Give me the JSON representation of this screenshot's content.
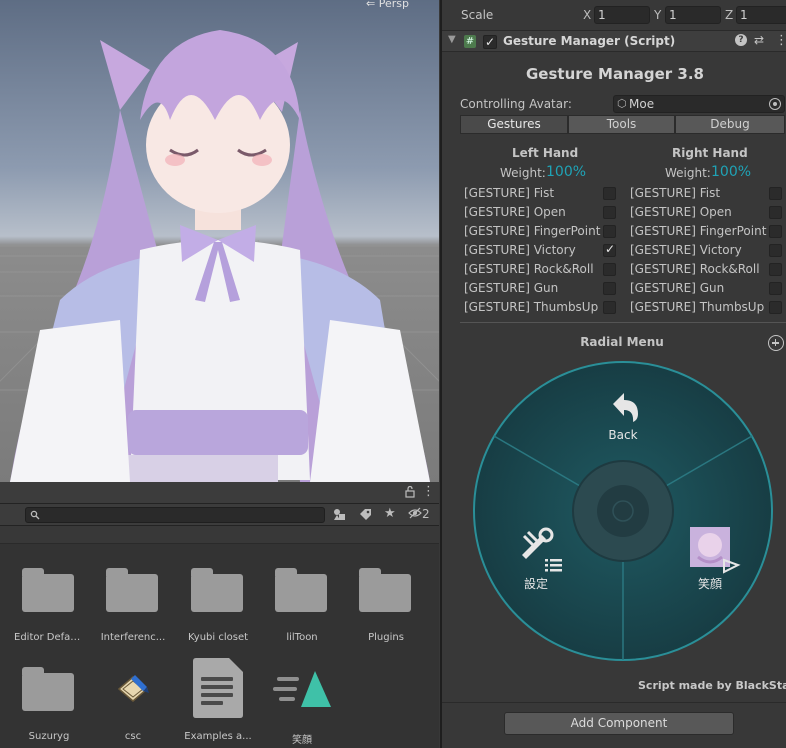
{
  "scene": {
    "view_label": "Persp"
  },
  "project": {
    "hidden_count": "2",
    "assets": [
      {
        "label": "Editor Defau...",
        "icon": "folder-icon"
      },
      {
        "label": "Interferenc...",
        "icon": "folder-icon"
      },
      {
        "label": "Kyubi closet",
        "icon": "folder-icon"
      },
      {
        "label": "lilToon",
        "icon": "folder-icon"
      },
      {
        "label": "Plugins",
        "icon": "folder-icon"
      },
      {
        "label": "Suzuryg",
        "icon": "folder-icon"
      },
      {
        "label": "csc",
        "icon": "script-asset-icon"
      },
      {
        "label": "Examples a...",
        "icon": "text-document-icon"
      },
      {
        "label": "笑顔",
        "icon": "animation-clip-icon"
      }
    ]
  },
  "inspector": {
    "scale": {
      "label": "Scale",
      "x_label": "X",
      "x": "1",
      "y_label": "Y",
      "y": "1",
      "z_label": "Z",
      "z": "1"
    },
    "component": {
      "title": "Gesture Manager (Script)",
      "heading": "Gesture Manager 3.8",
      "avatar_label": "Controlling Avatar:",
      "avatar_value": "Moe",
      "tabs": [
        "Gestures",
        "Tools",
        "Debug"
      ],
      "active_tab": "Gestures",
      "left_hand": {
        "title": "Left Hand",
        "weight_label": "Weight:",
        "weight_value": "100%",
        "gestures": [
          "[GESTURE] Fist",
          "[GESTURE] Open",
          "[GESTURE] FingerPoint",
          "[GESTURE] Victory",
          "[GESTURE] Rock&Roll",
          "[GESTURE] Gun",
          "[GESTURE] ThumbsUp"
        ],
        "checked": [
          false,
          false,
          false,
          true,
          false,
          false,
          false
        ]
      },
      "right_hand": {
        "title": "Right Hand",
        "weight_label": "Weight:",
        "weight_value": "100%",
        "gestures": [
          "[GESTURE] Fist",
          "[GESTURE] Open",
          "[GESTURE] FingerPoint",
          "[GESTURE] Victory",
          "[GESTURE] Rock&Roll",
          "[GESTURE] Gun",
          "[GESTURE] ThumbsUp"
        ],
        "checked": [
          false,
          false,
          false,
          false,
          false,
          false,
          false
        ]
      },
      "radial_menu": {
        "title": "Radial Menu",
        "items": [
          {
            "label": "Back",
            "icon": "back-arrow-icon"
          },
          {
            "label": "設定",
            "icon": "tools-icon"
          },
          {
            "label": "笑顔",
            "icon": "expression-thumbnail-icon"
          }
        ]
      },
      "credit": "Script made by BlackStartx"
    },
    "add_component_label": "Add Component"
  },
  "colors": {
    "accent": "#1fa3b6",
    "radial_fill": "#1c4a52",
    "radial_ring": "#2a8f98"
  }
}
